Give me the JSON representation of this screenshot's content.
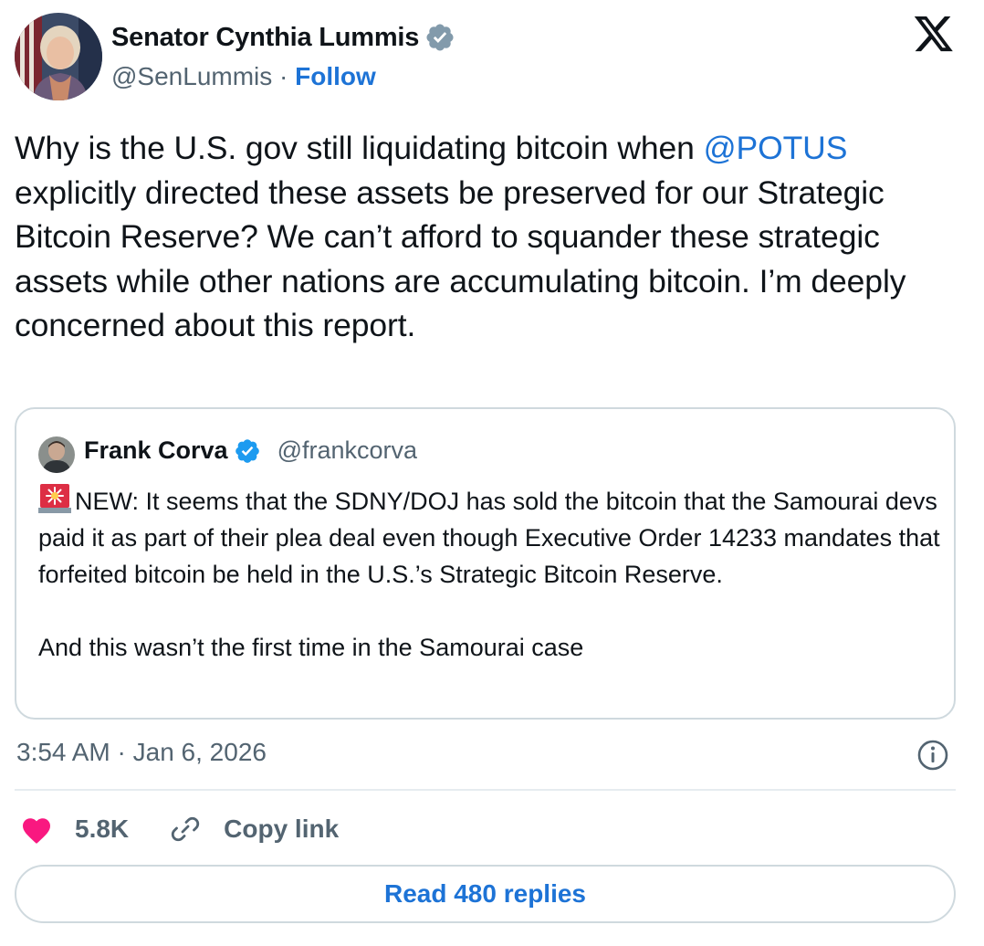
{
  "author": {
    "name": "Senator Cynthia Lummis",
    "handle": "@SenLummis",
    "separator": "·",
    "follow_label": "Follow"
  },
  "tweet": {
    "text_before_mention": "Why is the U.S. gov still liquidating bitcoin when ",
    "mention": "@POTUS",
    "text_after_mention": " explicitly directed these assets be preserved for our Strategic Bitcoin Reserve? We can’t afford to squander these strategic assets while other nations are accumulating bitcoin. I’m deeply concerned about this report."
  },
  "quote": {
    "name": "Frank Corva",
    "handle": "@frankcorva",
    "text": "NEW: It seems that the SDNY/DOJ has sold the bitcoin that the Samourai devs paid it as part of their plea deal even though Executive Order 14233 mandates that forfeited bitcoin be held in the U.S.’s Strategic Bitcoin Reserve.\n\nAnd this wasn’t the first time in the Samourai case"
  },
  "meta": {
    "time": "3:54 AM",
    "separator": "·",
    "date": "Jan 6, 2026"
  },
  "actions": {
    "likes": "5.8K",
    "copy_link_label": "Copy link",
    "read_replies_label": "Read 480 replies"
  },
  "colors": {
    "accent": "#1d73d6",
    "verified": "#1d9bf0",
    "heart": "#f91880",
    "muted_text": "#536471",
    "border": "#cfd9de"
  },
  "icons": {
    "verified": "verified-badge-icon",
    "x_logo": "x-logo-icon",
    "siren": "rotating-light-emoji",
    "info": "info-icon",
    "heart": "heart-icon",
    "link": "link-icon"
  }
}
